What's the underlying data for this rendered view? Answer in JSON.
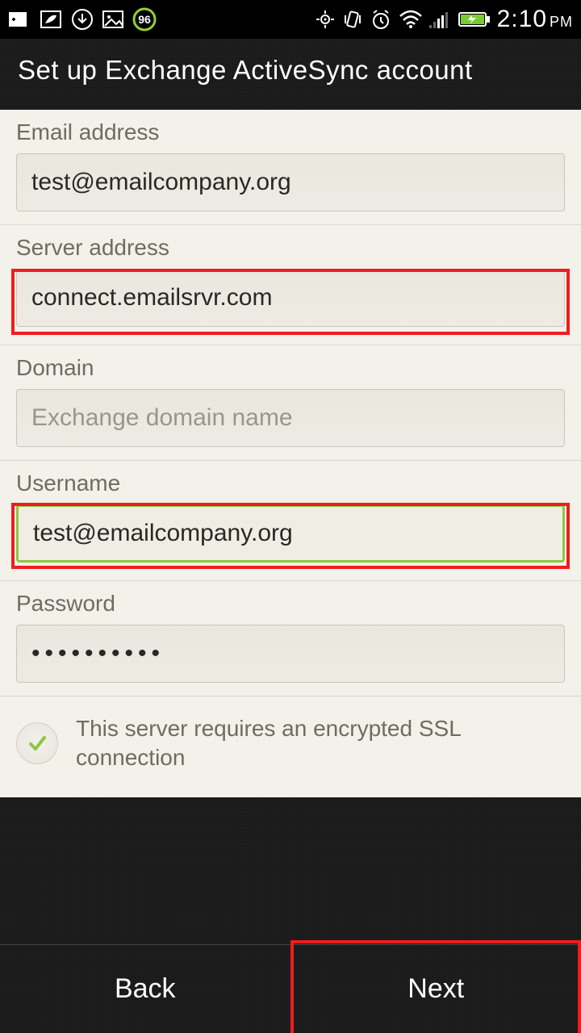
{
  "statusbar": {
    "battery_badge": "96",
    "time": "2:10",
    "ampm": "PM"
  },
  "header": {
    "title": "Set up Exchange ActiveSync account"
  },
  "fields": {
    "email": {
      "label": "Email address",
      "value": "test@emailcompany.org",
      "placeholder": ""
    },
    "server": {
      "label": "Server address",
      "value": "connect.emailsrvr.com",
      "placeholder": ""
    },
    "domain": {
      "label": "Domain",
      "value": "",
      "placeholder": "Exchange domain name"
    },
    "username": {
      "label": "Username",
      "value": "test@emailcompany.org",
      "placeholder": ""
    },
    "password": {
      "label": "Password",
      "value": "••••••••••",
      "placeholder": ""
    }
  },
  "ssl": {
    "label": "This server requires an encrypted SSL connection",
    "checked": true
  },
  "footer": {
    "back": "Back",
    "next": "Next"
  }
}
